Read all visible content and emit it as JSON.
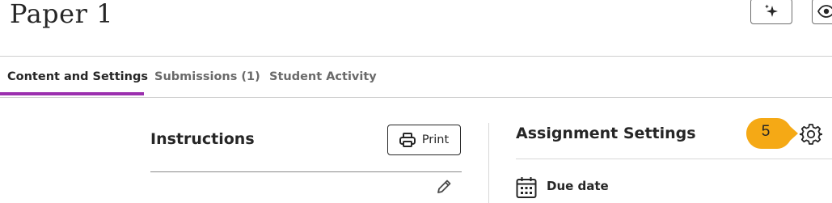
{
  "header": {
    "title": "Paper 1",
    "ai_button_icon": "sparkle-icon",
    "preview_button_icon": "eye-icon"
  },
  "tabs": [
    {
      "label": "Content and Settings",
      "active": true
    },
    {
      "label": "Submissions (1)",
      "active": false
    },
    {
      "label": "Student Activity",
      "active": false
    }
  ],
  "instructions": {
    "heading": "Instructions",
    "print_label": "Print",
    "edit_icon": "pencil-icon"
  },
  "settings": {
    "heading": "Assignment Settings",
    "callout_number": "5",
    "settings_icon": "gear-icon",
    "due_date_label": "Due date"
  },
  "colors": {
    "accent": "#9b2fae",
    "callout": "#f5a915",
    "text": "#262626"
  }
}
